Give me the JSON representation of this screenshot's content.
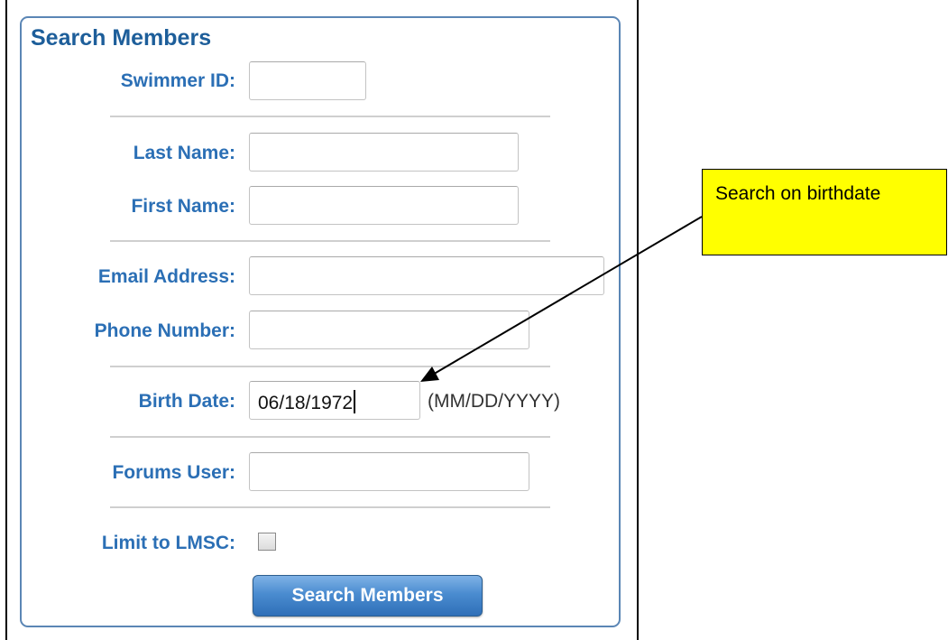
{
  "form": {
    "title": "Search Members",
    "fields": {
      "swimmer_id": {
        "label": "Swimmer ID:",
        "value": ""
      },
      "last_name": {
        "label": "Last Name:",
        "value": ""
      },
      "first_name": {
        "label": "First Name:",
        "value": ""
      },
      "email": {
        "label": "Email Address:",
        "value": ""
      },
      "phone": {
        "label": "Phone Number:",
        "value": ""
      },
      "birth_date": {
        "label": "Birth Date:",
        "value": "06/18/1972",
        "hint": "(MM/DD/YYYY)"
      },
      "forums_user": {
        "label": "Forums User:",
        "value": ""
      },
      "limit_lmsc": {
        "label": "Limit to LMSC:",
        "checked": false
      }
    },
    "submit_label": "Search Members",
    "accent_color": "#2b6fb5"
  },
  "annotation": {
    "text": "Search on birthdate",
    "background": "#ffff00"
  }
}
